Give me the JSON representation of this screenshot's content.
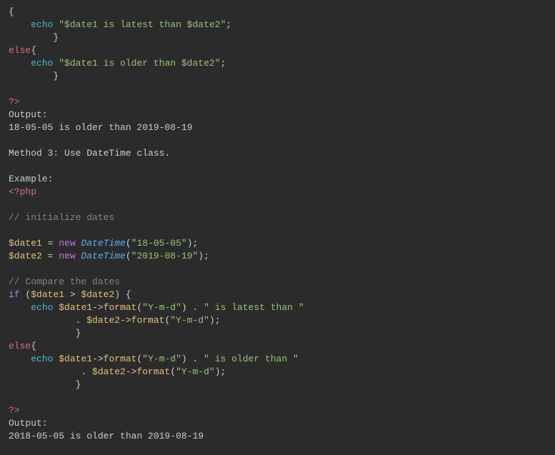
{
  "code": {
    "l1": "{",
    "l2a": "    ",
    "l2_echo": "echo",
    "l2b": " ",
    "l2_str": "\"$date1 is latest than $date2\"",
    "l2c": ";",
    "l3": "        }",
    "l4_else": "else",
    "l4b": "{",
    "l5a": "    ",
    "l5_echo": "echo",
    "l5b": " ",
    "l5_str": "\"$date1 is older than $date2\"",
    "l5c": ";",
    "l6": "        }",
    "blank1": "",
    "l8_close": "?>",
    "l9": "Output:",
    "l10": "18-05-05 is older than 2019-08-19",
    "blank2": "",
    "l12": "Method 3: Use DateTime class.",
    "blank3": "",
    "l14": "Example:",
    "l15_open": "<?php",
    "blank4": "",
    "l17_cmt": "// initialize dates",
    "blank5": "",
    "l19_var": "$date1",
    "l19_eq": " = ",
    "l19_new": "new",
    "l19_sp": " ",
    "l19_type": "DateTime",
    "l19_p1": "(",
    "l19_str": "\"18-05-05\"",
    "l19_p2": ");",
    "l20_var": "$date2",
    "l20_eq": " = ",
    "l20_new": "new",
    "l20_sp": " ",
    "l20_type": "DateTime",
    "l20_p1": "(",
    "l20_str": "\"2019-08-19\"",
    "l20_p2": ");",
    "blank6": "",
    "l22_cmt": "// Compare the dates",
    "l23_if": "if",
    "l23a": " (",
    "l23_v1": "$date1",
    "l23_op": " > ",
    "l23_v2": "$date2",
    "l23b": ") {",
    "l24a": "    ",
    "l24_echo": "echo",
    "l24b": " ",
    "l24_v": "$date1",
    "l24_arr": "->",
    "l24_fn": "format",
    "l24_p1": "(",
    "l24_s1": "\"Y-m-d\"",
    "l24_p2": ")",
    "l24_dot": " . ",
    "l24_s2": "\" is latest than \"",
    "l25a": "            ",
    "l25_dot": ". ",
    "l25_v": "$date2",
    "l25_arr": "->",
    "l25_fn": "format",
    "l25_p1": "(",
    "l25_s": "\"Y-m-d\"",
    "l25_p2": ");",
    "l26": "            }",
    "l27_else": "else",
    "l27b": "{",
    "l28a": "    ",
    "l28_echo": "echo",
    "l28b": " ",
    "l28_v": "$date1",
    "l28_arr": "->",
    "l28_fn": "format",
    "l28_p1": "(",
    "l28_s1": "\"Y-m-d\"",
    "l28_p2": ")",
    "l28_dot": " . ",
    "l28_s2": "\" is older than \"",
    "l29a": "             ",
    "l29_dot": ". ",
    "l29_v": "$date2",
    "l29_arr": "->",
    "l29_fn": "format",
    "l29_p1": "(",
    "l29_s": "\"Y-m-d\"",
    "l29_p2": ");",
    "l30": "            }",
    "blank7": "",
    "l32_close": "?>",
    "l33": "Output:",
    "l34": "2018-05-05 is older than 2019-08-19"
  }
}
